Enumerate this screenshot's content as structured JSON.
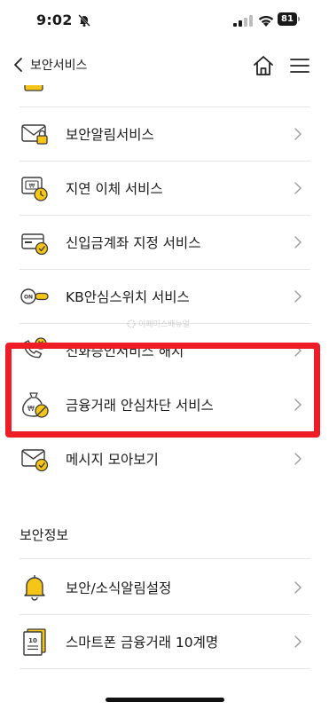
{
  "status_bar": {
    "time": "9:02",
    "battery": "81",
    "icons": [
      "bell-slash-icon",
      "cellular-signal-icon",
      "wifi-icon",
      "battery-icon"
    ]
  },
  "nav": {
    "back_label": "보안서비스",
    "icons": [
      "chevron-left-icon",
      "home-icon",
      "hamburger-menu-icon"
    ]
  },
  "list": {
    "items": [
      {
        "label": "보안알림서비스",
        "icon": "envelope-lock-icon"
      },
      {
        "label": "지연 이체 서비스",
        "icon": "transfer-clock-icon"
      },
      {
        "label": "신입금계좌 지정 서비스",
        "icon": "card-check-icon"
      },
      {
        "label": "KB안심스위치 서비스",
        "icon": "toggle-switch-icon"
      },
      {
        "label": "전화승인서비스 해지",
        "icon": "phone-cancel-icon"
      },
      {
        "label": "금융거래 안심차단 서비스",
        "icon": "money-bag-block-icon"
      },
      {
        "label": "메시지 모아보기",
        "icon": "envelope-check-icon"
      }
    ]
  },
  "section": {
    "title": "보안정보",
    "items": [
      {
        "label": "보안/소식알림설정",
        "icon": "bell-icon"
      },
      {
        "label": "스마트폰 금융거래 10계명",
        "icon": "document-10-icon"
      }
    ]
  },
  "watermark": {
    "text": "이페미스배뉴얼"
  },
  "colors": {
    "accent": "#f5c518",
    "highlight": "#ee1c25",
    "icon_stroke": "#3a3a3a"
  }
}
